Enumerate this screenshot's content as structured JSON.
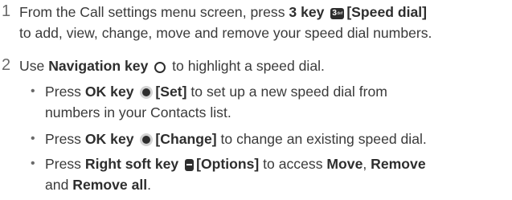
{
  "steps": [
    {
      "number": "1",
      "line1_a": "From the Call settings menu screen, press ",
      "key": "3 key",
      "icon_number": "3",
      "icon_letters": "def",
      "option": "[Speed dial]",
      "line2": "to add, view, change, move and remove your speed dial numbers."
    },
    {
      "number": "2",
      "text_a": "Use ",
      "key": "Navigation key",
      "text_b": " to highlight a speed dial."
    }
  ],
  "bullets": [
    {
      "dot": "•",
      "text_a": "Press ",
      "key": "OK key",
      "option": "[Set]",
      "text_b": " to set up a new speed dial from",
      "line2": "numbers in your Contacts list."
    },
    {
      "dot": "•",
      "text_a": "Press ",
      "key": "OK key",
      "option": "[Change]",
      "text_b": " to change an existing speed dial."
    },
    {
      "dot": "•",
      "text_a": "Press ",
      "key": "Right soft key",
      "option": "[Options]",
      "text_b": " to access ",
      "move": "Move",
      "sep1": ", ",
      "remove": "Remove",
      "line2_and": "and ",
      "remove_all": "Remove all",
      "period": "."
    }
  ]
}
